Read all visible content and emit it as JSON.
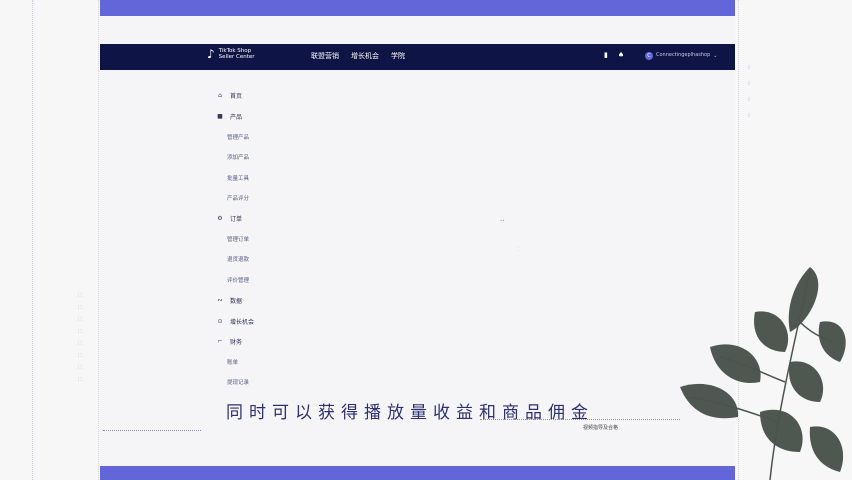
{
  "header": {
    "brand_line1": "TikTok Shop",
    "brand_line2": "Seller Center",
    "nav": [
      "联盟营销",
      "增长机会",
      "学院"
    ],
    "account_name": "Connectingeplhashop"
  },
  "sidebar": {
    "items": [
      {
        "icon": "home-icon",
        "label": "首页",
        "sub": []
      },
      {
        "icon": "product-icon",
        "label": "产品",
        "sub": [
          "管理产品",
          "添加产品",
          "批量工具",
          "产品评分"
        ]
      },
      {
        "icon": "order-icon",
        "label": "订单",
        "sub": [
          "管理订单",
          "退货退款",
          "评价管理"
        ]
      },
      {
        "icon": "analytics-icon",
        "label": "数据",
        "sub": []
      },
      {
        "icon": "growth-icon",
        "label": "增长机会",
        "sub": []
      },
      {
        "icon": "finance-icon",
        "label": "财务",
        "sub": [
          "账单",
          "提现记录"
        ]
      }
    ]
  },
  "caption": "同时可以获得播放量收益和商品佣金",
  "footnote": "视频指导及合格",
  "colors": {
    "band": "#6366d8",
    "header": "#0e1445",
    "canvas": "#f5f5f8"
  }
}
